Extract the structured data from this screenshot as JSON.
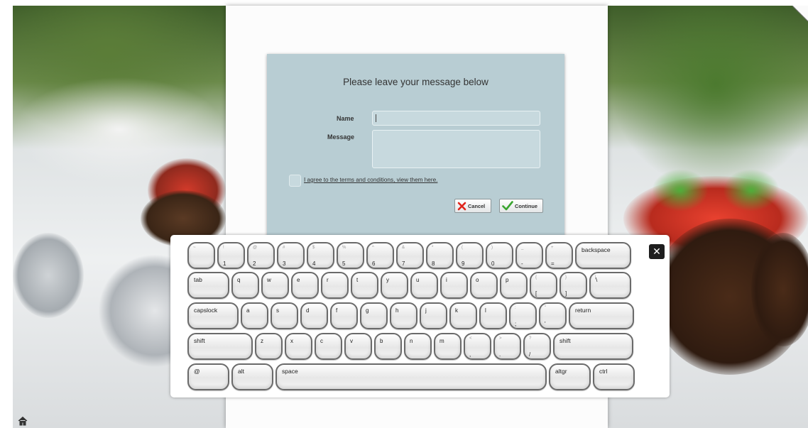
{
  "form": {
    "title": "Please leave your message below",
    "name_label": "Name",
    "message_label": "Message",
    "terms_text": "I agree to the terms and conditions, view them here.",
    "cancel_label": "Cancel",
    "continue_label": "Continue"
  },
  "keyboard": {
    "rows": [
      [
        {
          "label": "",
          "sub": "~"
        },
        {
          "label": "1",
          "sub": "!"
        },
        {
          "label": "2",
          "sub": "@"
        },
        {
          "label": "3",
          "sub": "#"
        },
        {
          "label": "4",
          "sub": "$"
        },
        {
          "label": "5",
          "sub": "%"
        },
        {
          "label": "6",
          "sub": "^"
        },
        {
          "label": "7",
          "sub": "&"
        },
        {
          "label": "8",
          "sub": "*"
        },
        {
          "label": "9",
          "sub": "("
        },
        {
          "label": "0",
          "sub": ")"
        },
        {
          "label": "-",
          "sub": "_"
        },
        {
          "label": "=",
          "sub": "+"
        },
        {
          "label": "backspace",
          "sub": ""
        }
      ],
      [
        {
          "label": "tab",
          "sub": ""
        },
        {
          "label": "q",
          "sub": ""
        },
        {
          "label": "w",
          "sub": ""
        },
        {
          "label": "e",
          "sub": ""
        },
        {
          "label": "r",
          "sub": ""
        },
        {
          "label": "t",
          "sub": ""
        },
        {
          "label": "y",
          "sub": ""
        },
        {
          "label": "u",
          "sub": ""
        },
        {
          "label": "i",
          "sub": ""
        },
        {
          "label": "o",
          "sub": ""
        },
        {
          "label": "p",
          "sub": ""
        },
        {
          "label": "[",
          "sub": "{"
        },
        {
          "label": "]",
          "sub": "}"
        },
        {
          "label": "\\",
          "sub": "|"
        }
      ],
      [
        {
          "label": "capslock",
          "sub": ""
        },
        {
          "label": "a",
          "sub": ""
        },
        {
          "label": "s",
          "sub": ""
        },
        {
          "label": "d",
          "sub": ""
        },
        {
          "label": "f",
          "sub": ""
        },
        {
          "label": "g",
          "sub": ""
        },
        {
          "label": "h",
          "sub": ""
        },
        {
          "label": "j",
          "sub": ""
        },
        {
          "label": "k",
          "sub": ""
        },
        {
          "label": "l",
          "sub": ""
        },
        {
          "label": ";",
          "sub": ":"
        },
        {
          "label": "'",
          "sub": "\""
        },
        {
          "label": "return",
          "sub": ""
        }
      ],
      [
        {
          "label": "shift",
          "sub": ""
        },
        {
          "label": "z",
          "sub": ""
        },
        {
          "label": "x",
          "sub": ""
        },
        {
          "label": "c",
          "sub": ""
        },
        {
          "label": "v",
          "sub": ""
        },
        {
          "label": "b",
          "sub": ""
        },
        {
          "label": "n",
          "sub": ""
        },
        {
          "label": "m",
          "sub": ""
        },
        {
          "label": ",",
          "sub": "<"
        },
        {
          "label": ".",
          "sub": ">"
        },
        {
          "label": "/",
          "sub": "?"
        },
        {
          "label": "shift",
          "sub": ""
        }
      ],
      [
        {
          "label": "@",
          "sub": ""
        },
        {
          "label": "alt",
          "sub": ""
        },
        {
          "label": "space",
          "sub": ""
        },
        {
          "label": "altgr",
          "sub": ""
        },
        {
          "label": "ctrl",
          "sub": ""
        }
      ]
    ]
  },
  "icons": {
    "close": "close-icon",
    "home": "home-icon",
    "cancel": "x-icon",
    "continue": "check-icon"
  },
  "colors": {
    "panel": "#b8cdd3",
    "keyboard_border": "#6a6a6a",
    "cancel_icon": "#e0241b",
    "continue_icon": "#3aa52f"
  }
}
